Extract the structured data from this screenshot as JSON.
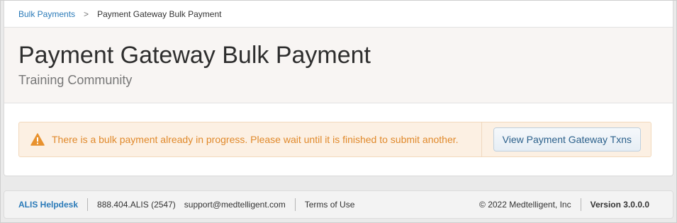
{
  "breadcrumb": {
    "parent": "Bulk Payments",
    "separator": ">",
    "current": "Payment Gateway Bulk Payment"
  },
  "header": {
    "title": "Payment Gateway Bulk Payment",
    "subtitle": "Training Community"
  },
  "alert": {
    "icon": "warning-icon",
    "message": "There is a bulk payment already in progress. Please wait until it is finished to submit another.",
    "button_label": "View Payment Gateway Txns",
    "color": "#e0892b"
  },
  "footer": {
    "helpdesk": "ALIS Helpdesk",
    "phone": "888.404.ALIS (2547)",
    "email": "support@medtelligent.com",
    "terms": "Terms of Use",
    "copyright": "© 2022 Medtelligent, Inc",
    "version": "Version 3.0.0.0"
  },
  "colors": {
    "link": "#2a7ab8",
    "alert_bg": "#fcf0e3",
    "header_bg": "#f8f5f3"
  }
}
